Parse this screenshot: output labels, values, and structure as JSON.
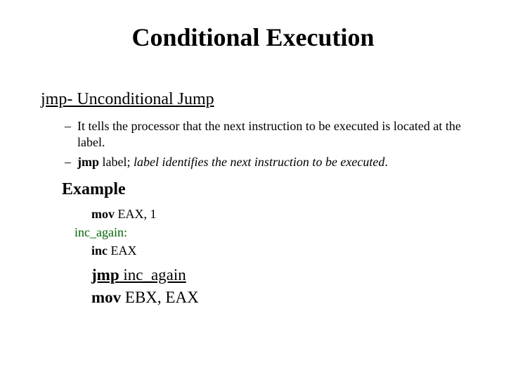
{
  "title": "Conditional Execution",
  "subheading": {
    "mnemonic": "jmp",
    "rest": "- Unconditional Jump"
  },
  "bullets": [
    {
      "dash": "–",
      "text": "It tells the processor that the next instruction to be executed is located at the label."
    },
    {
      "dash": "–",
      "jmp": "jmp",
      "label_word": " label;",
      "rest_italic": " label identifies the next instruction to be executed",
      "period": "."
    }
  ],
  "example_heading": "Example",
  "code": {
    "line1_mov": "mov",
    "line1_rest": " EAX, 1",
    "line2": "inc_again:",
    "line3_inc": "inc",
    "line3_rest": " EAX",
    "line4_jmp": "jmp",
    "line4_rest": " inc_again",
    "line5_mov": "mov",
    "line5_rest": " EBX, EAX"
  }
}
